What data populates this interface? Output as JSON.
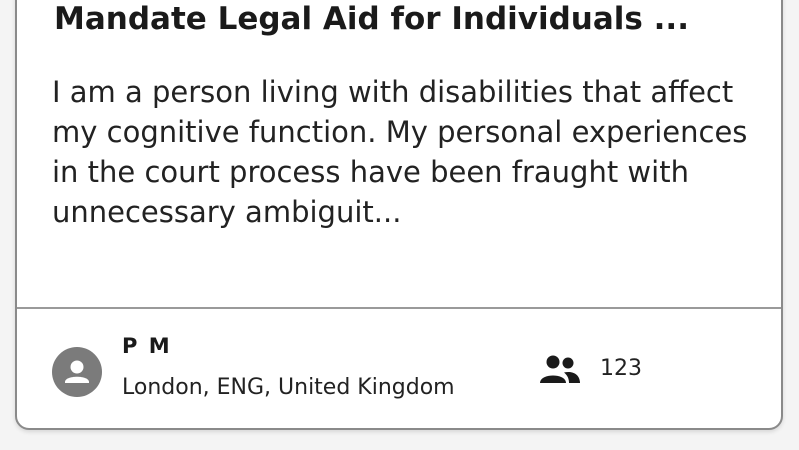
{
  "petition": {
    "title": "Mandate Legal Aid for Individuals ...",
    "description": "I am a person living with disabilities that affect my cognitive function. My personal experiences in the court process have been fraught with unnecessary ambiguit...",
    "author": {
      "name": "P M",
      "location": "London, ENG, United Kingdom",
      "avatar_icon": "person-icon"
    },
    "supporters": {
      "icon": "people-icon",
      "count": "123"
    }
  },
  "colors": {
    "card_border": "#8a8a8a",
    "avatar_bg": "#7b7b7b",
    "text": "#1a1a1a"
  }
}
